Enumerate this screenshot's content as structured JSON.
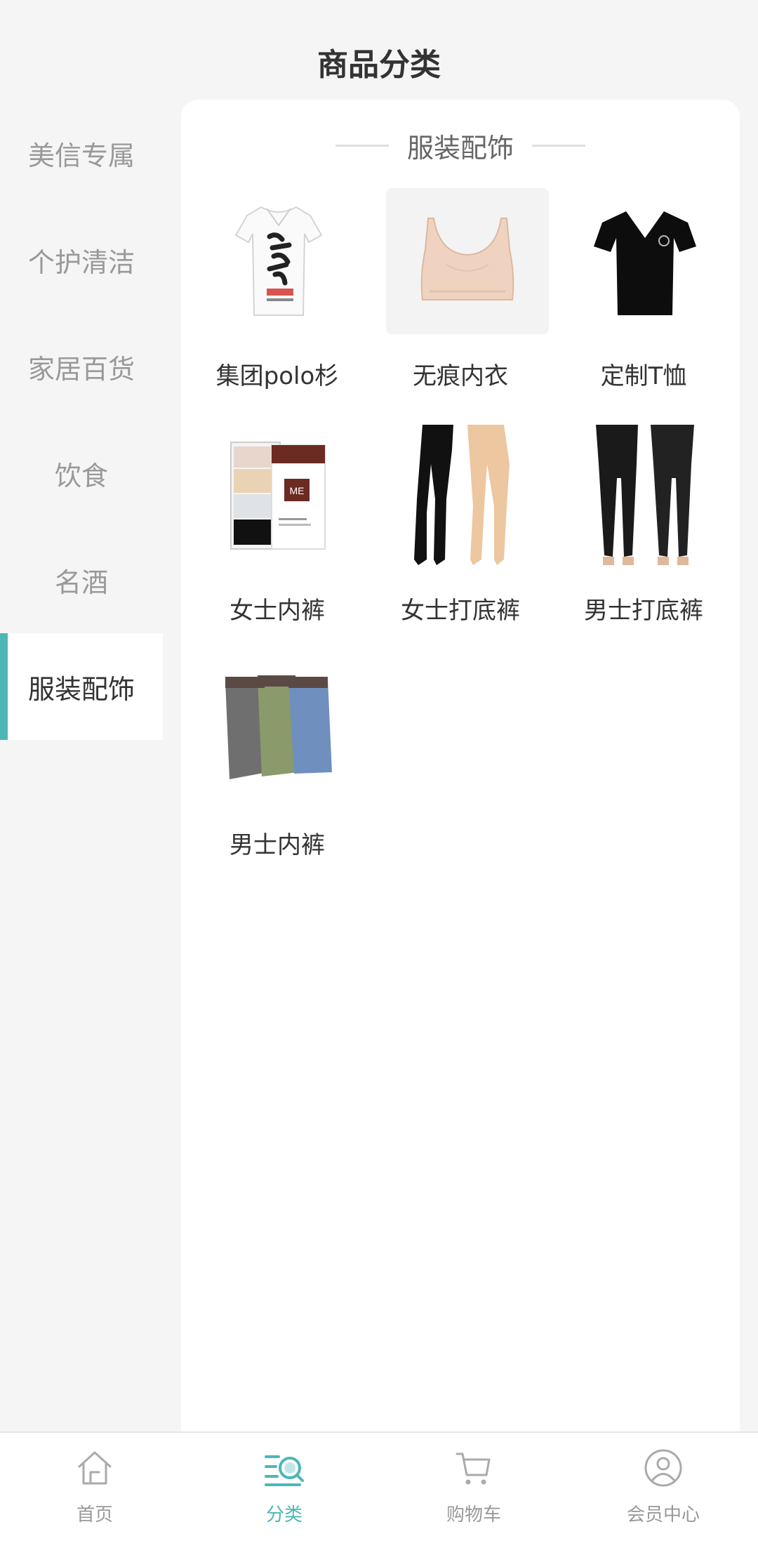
{
  "header": {
    "title": "商品分类"
  },
  "sidebar": {
    "items": [
      {
        "label": "美信专属",
        "active": false
      },
      {
        "label": "个护清洁",
        "active": false
      },
      {
        "label": "家居百货",
        "active": false
      },
      {
        "label": "饮食",
        "active": false
      },
      {
        "label": "名酒",
        "active": false
      },
      {
        "label": "服装配饰",
        "active": true
      }
    ]
  },
  "content": {
    "section_title": "服装配饰",
    "products": [
      {
        "label": "集团polo杉",
        "image": "white-polo-shirt"
      },
      {
        "label": "无痕内衣",
        "image": "seamless-bra"
      },
      {
        "label": "定制T恤",
        "image": "black-tshirt"
      },
      {
        "label": "女士内裤",
        "image": "womens-underwear-box"
      },
      {
        "label": "女士打底裤",
        "image": "womens-leggings"
      },
      {
        "label": "男士打底裤",
        "image": "mens-leggings"
      },
      {
        "label": "男士内裤",
        "image": "mens-boxers"
      }
    ]
  },
  "tabbar": {
    "items": [
      {
        "label": "首页",
        "icon": "home-icon",
        "active": false
      },
      {
        "label": "分类",
        "icon": "category-search-icon",
        "active": true
      },
      {
        "label": "购物车",
        "icon": "cart-icon",
        "active": false
      },
      {
        "label": "会员中心",
        "icon": "user-icon",
        "active": false
      }
    ]
  },
  "colors": {
    "accent": "#4fb6b6",
    "inactive": "#999999",
    "background": "#f5f5f5"
  }
}
